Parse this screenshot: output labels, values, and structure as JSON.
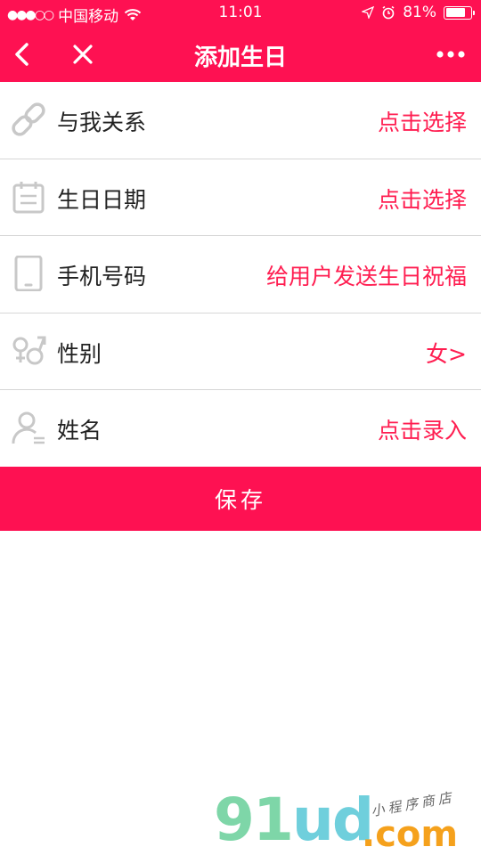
{
  "status_bar": {
    "signal": "●●●○○",
    "carrier": "中国移动",
    "time": "11:01",
    "battery_percent": "81%",
    "battery_level": 0.81
  },
  "nav": {
    "title": "添加生日"
  },
  "rows": [
    {
      "label": "与我关系",
      "value": "点击选择",
      "icon": "link-icon"
    },
    {
      "label": "生日日期",
      "value": "点击选择",
      "icon": "calendar-icon"
    },
    {
      "label": "手机号码",
      "value": "给用户发送生日祝福",
      "icon": "phone-icon"
    },
    {
      "label": "性别",
      "value": "女>",
      "icon": "gender-icon"
    },
    {
      "label": "姓名",
      "value": "点击录入",
      "icon": "user-icon"
    }
  ],
  "save_label": "保存",
  "watermark": {
    "logo": "91ud",
    "domain": ".com",
    "tagline": "小程序商店"
  },
  "colors": {
    "accent": "#fe1152",
    "value_text": "#ff1d50",
    "icon_gray": "#c8c8c8",
    "watermark_green": "#7ed6a8",
    "watermark_orange": "#f5a11c"
  }
}
